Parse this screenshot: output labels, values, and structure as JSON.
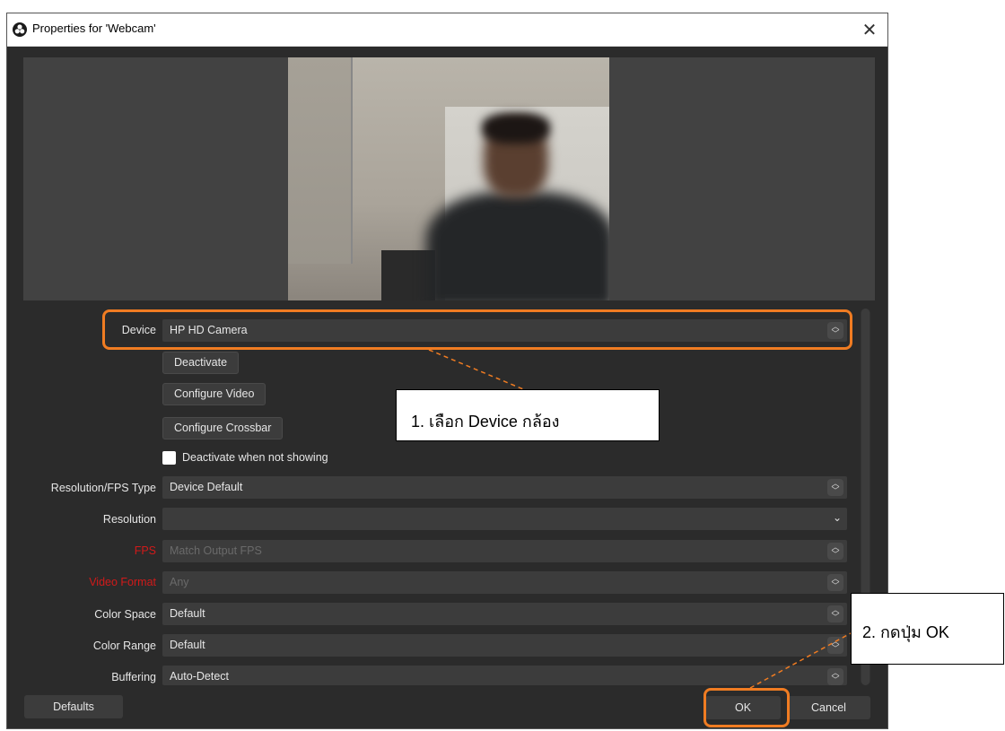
{
  "window": {
    "title": "Properties for 'Webcam'",
    "close_glyph": "✕",
    "app_icon": "obs-logo-icon"
  },
  "form": {
    "device": {
      "label": "Device",
      "value": "HP HD Camera"
    },
    "buttons": {
      "deactivate": "Deactivate",
      "configure_video": "Configure Video",
      "configure_crossbar": "Configure Crossbar"
    },
    "deactivate_when_not_showing": {
      "label": "Deactivate when not showing",
      "checked": false
    },
    "resolution_fps_type": {
      "label": "Resolution/FPS Type",
      "value": "Device Default"
    },
    "resolution": {
      "label": "Resolution",
      "value": ""
    },
    "fps": {
      "label": "FPS",
      "value": "Match Output FPS"
    },
    "video_format": {
      "label": "Video Format",
      "value": "Any"
    },
    "color_space": {
      "label": "Color Space",
      "value": "Default"
    },
    "color_range": {
      "label": "Color Range",
      "value": "Default"
    },
    "buffering": {
      "label": "Buffering",
      "value": "Auto-Detect"
    }
  },
  "footer": {
    "defaults": "Defaults",
    "ok": "OK",
    "cancel": "Cancel"
  },
  "annotations": {
    "step1": "1. เลือก Device กล้อง",
    "step2": "2. กดปุ่ม OK",
    "highlight_color": "#f07c22"
  },
  "colors": {
    "dialog_bg": "#2b2b2b",
    "field_bg": "#3c3c3c",
    "text": "#e6e6e6",
    "error_label": "#d11a1a"
  }
}
